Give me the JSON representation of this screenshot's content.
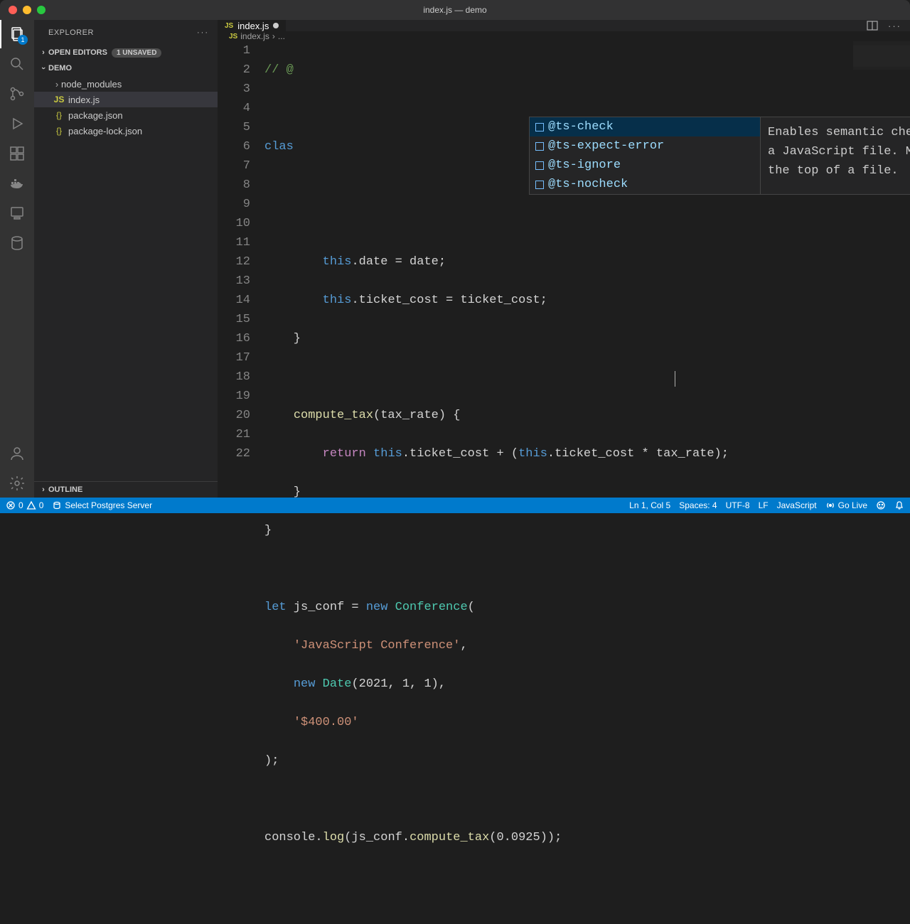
{
  "titlebar": {
    "title": "index.js — demo"
  },
  "activitybar": {
    "explorer_badge": "1"
  },
  "sidebar": {
    "title": "EXPLORER",
    "open_editors_label": "OPEN EDITORS",
    "unsaved_label": "1 UNSAVED",
    "project_name": "DEMO",
    "files": {
      "node_modules": "node_modules",
      "index_js": "index.js",
      "package_json": "package.json",
      "package_lock": "package-lock.json"
    },
    "outline_label": "OUTLINE"
  },
  "tab": {
    "label": "index.js"
  },
  "breadcrumbs": {
    "file": "index.js",
    "symbol": "..."
  },
  "code": {
    "lines": [
      "1",
      "2",
      "3",
      "4",
      "5",
      "6",
      "7",
      "8",
      "9",
      "10",
      "11",
      "12",
      "13",
      "14",
      "15",
      "16",
      "17",
      "18",
      "19",
      "20",
      "21",
      "22"
    ],
    "l1_comment": "// @",
    "l3_class": "clas",
    "l6_this": "this",
    "l6_prop": ".date = date;",
    "l7_this": "this",
    "l7_prop": ".ticket_cost = ticket_cost;",
    "l8": "    }",
    "l10_fn": "compute_tax",
    "l10_params": "(tax_rate) {",
    "l11_return": "return",
    "l11_this1": "this",
    "l11_mid": ".ticket_cost + (",
    "l11_this2": "this",
    "l11_end": ".ticket_cost * tax_rate);",
    "l12": "    }",
    "l13": "}",
    "l15_let": "let",
    "l15_var": " js_conf = ",
    "l15_new": "new",
    "l15_type": " Conference",
    "l15_end": "(",
    "l16_str": "'JavaScript Conference'",
    "l16_end": ",",
    "l17_new": "new",
    "l17_type": " Date",
    "l17_args": "(2021, 1, 1),",
    "l18_str": "'$400.00'",
    "l19": ");",
    "l21_a": "console.",
    "l21_fn": "log",
    "l21_b": "(js_conf.",
    "l21_fn2": "compute_tax",
    "l21_c": "(0.0925));"
  },
  "suggest": {
    "items": [
      "@ts-check",
      "@ts-expect-error",
      "@ts-ignore",
      "@ts-nocheck"
    ],
    "detail": "Enables semantic checking in a JavaScript file. Must be at the top of a file."
  },
  "statusbar": {
    "errors": "0",
    "warnings": "0",
    "postgres": "Select Postgres Server",
    "ln_col": "Ln 1, Col 5",
    "spaces": "Spaces: 4",
    "encoding": "UTF-8",
    "eol": "LF",
    "lang": "JavaScript",
    "golive": "Go Live"
  }
}
